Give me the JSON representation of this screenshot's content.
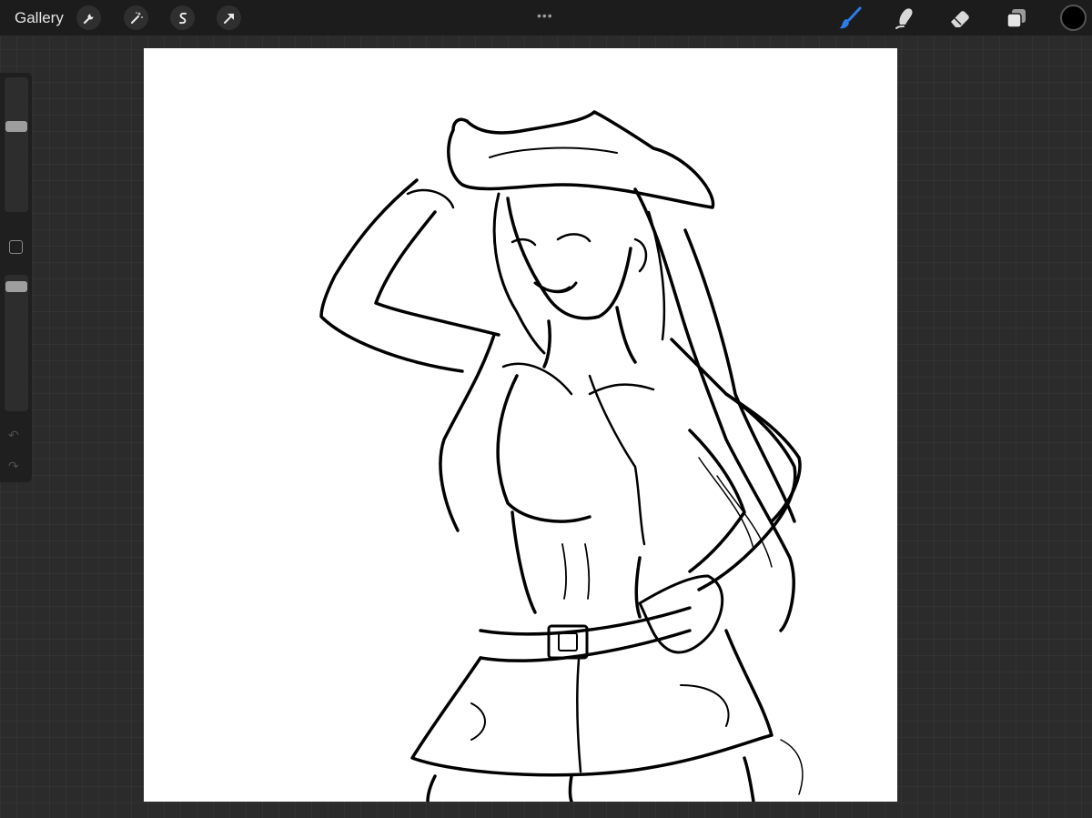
{
  "toolbar": {
    "gallery_label": "Gallery",
    "more_dots": "•••",
    "actions_icon": "wrench-icon",
    "adjustments_icon": "magic-wand-icon",
    "selection_icon": "selection-icon",
    "transform_icon": "arrow-icon",
    "brush_icon": "brush-icon",
    "smudge_icon": "smudge-icon",
    "eraser_icon": "eraser-icon",
    "layers_icon": "layers-icon",
    "active_color": "#000000",
    "active_tool_color": "#2b7de9"
  },
  "sidebar": {
    "brush_size_level": 0.65,
    "opacity_level": 0.95,
    "undo_icon": "undo-icon",
    "redo_icon": "redo-icon"
  },
  "canvas": {
    "background": "#ffffff",
    "artwork": "line-art-sketch"
  }
}
